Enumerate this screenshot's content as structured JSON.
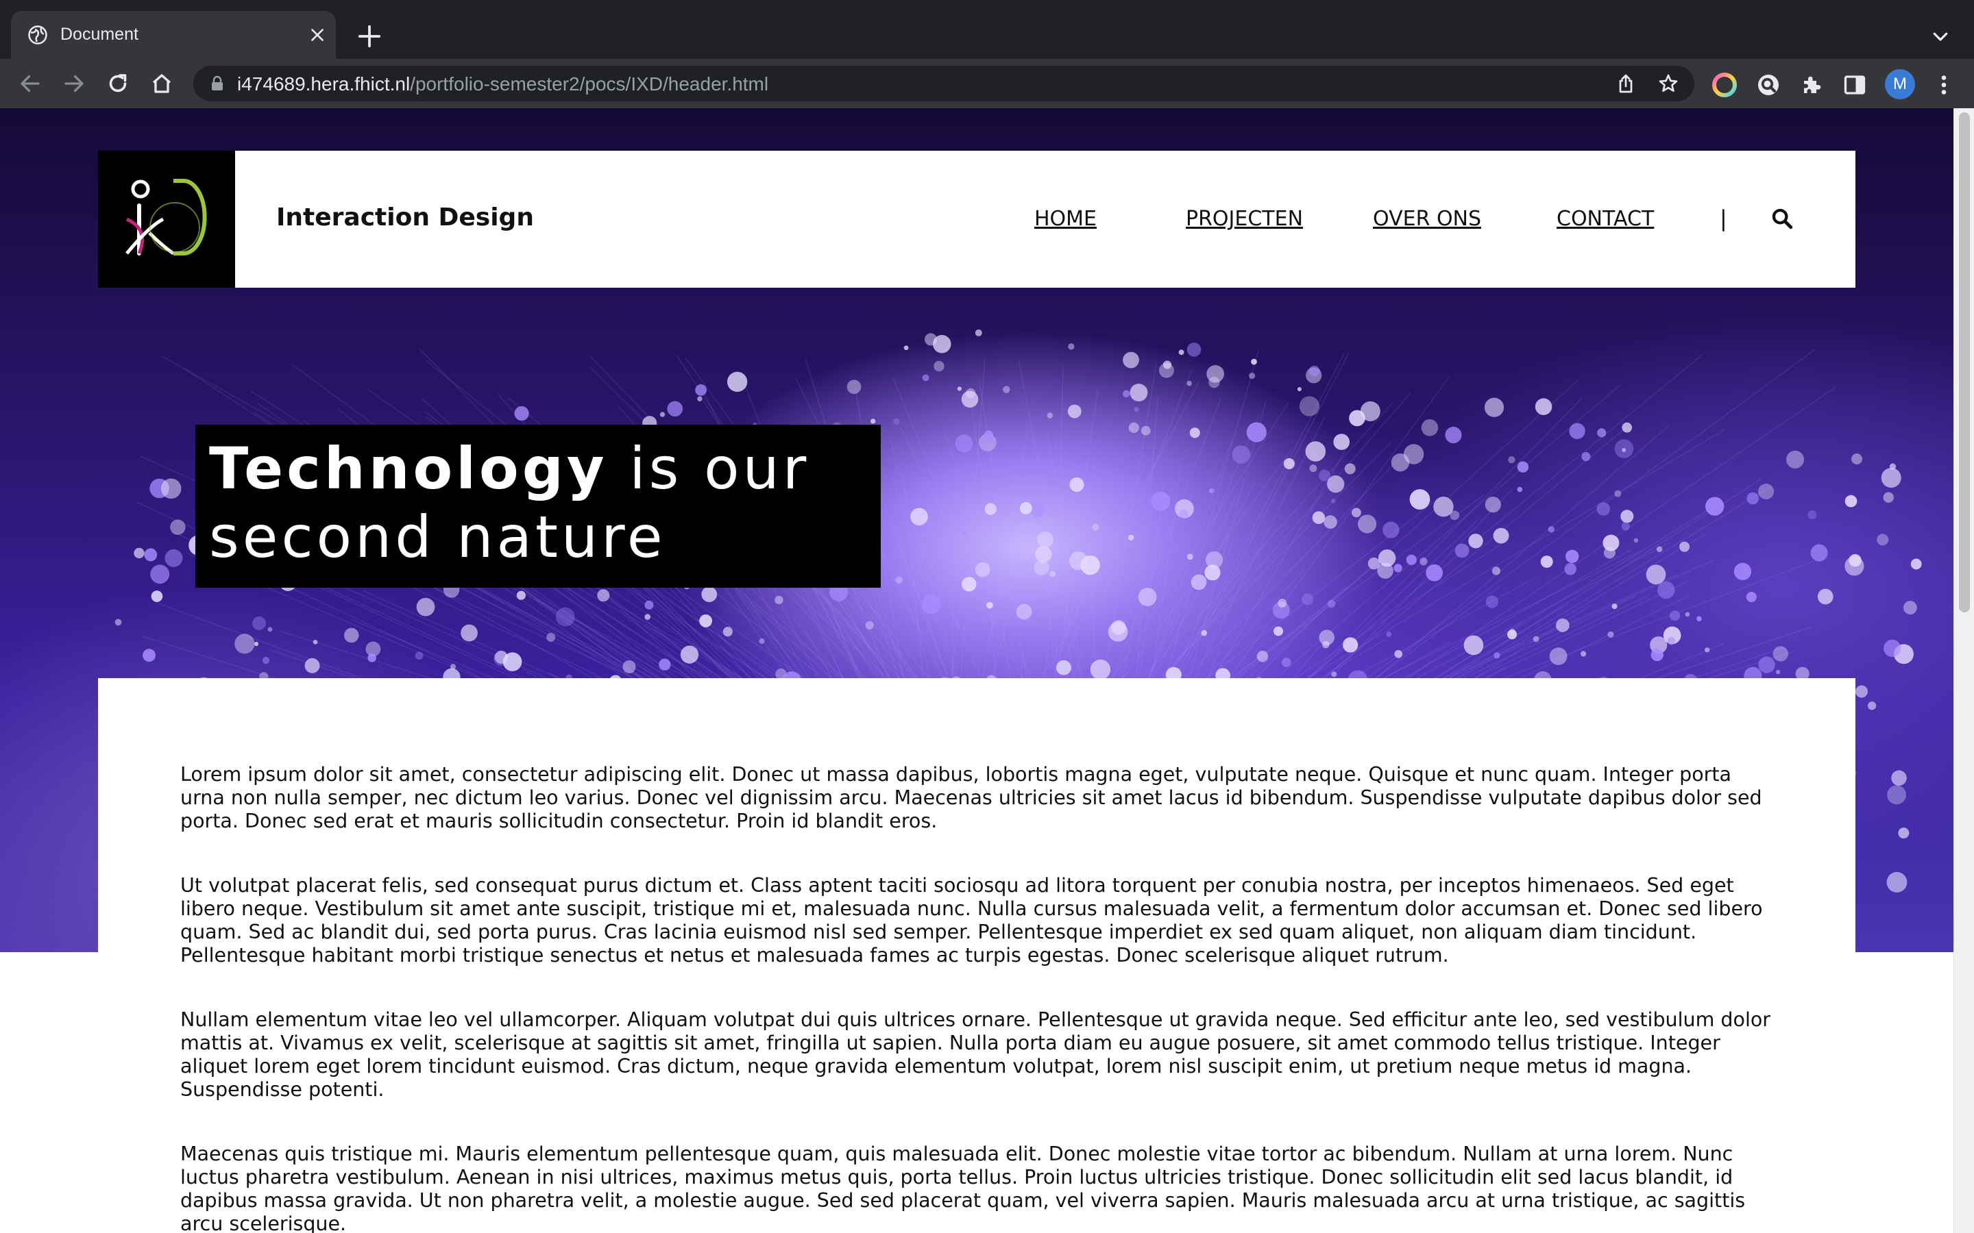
{
  "browser": {
    "tab_title": "Document",
    "url_host": "i474689.hera.fhict.nl",
    "url_path": "/portfolio-semester2/pocs/IXD/header.html",
    "profile_initial": "M"
  },
  "site": {
    "logo_text": "ixd",
    "title": "Interaction Design",
    "nav": [
      {
        "label": "HOME"
      },
      {
        "label": "PROJECTEN"
      },
      {
        "label": "OVER ONS"
      },
      {
        "label": "CONTACT"
      }
    ],
    "nav_separator": "|",
    "tagline_bold": "Technology",
    "tagline_rest_1": " is our",
    "tagline_rest_2": "second nature"
  },
  "content": {
    "paragraphs": [
      "Lorem ipsum dolor sit amet, consectetur adipiscing elit. Donec ut massa dapibus, lobortis magna eget, vulputate neque. Quisque et nunc quam. Integer porta urna non nulla semper, nec dictum leo varius. Donec vel dignissim arcu. Maecenas ultricies sit amet lacus id bibendum. Suspendisse vulputate dapibus dolor sed porta. Donec sed erat et mauris sollicitudin consectetur. Proin id blandit eros.",
      "Ut volutpat placerat felis, sed consequat purus dictum et. Class aptent taciti sociosqu ad litora torquent per conubia nostra, per inceptos himenaeos. Sed eget libero neque. Vestibulum sit amet ante suscipit, tristique mi et, malesuada nunc. Nulla cursus malesuada velit, a fermentum dolor accumsan et. Donec sed libero quam. Sed ac blandit dui, sed porta purus. Cras lacinia euismod nisl sed semper. Pellentesque imperdiet ex sed quam aliquet, non aliquam diam tincidunt. Pellentesque habitant morbi tristique senectus et netus et malesuada fames ac turpis egestas. Donec scelerisque aliquet rutrum.",
      "Nullam elementum vitae leo vel ullamcorper. Aliquam volutpat dui quis ultrices ornare. Pellentesque ut gravida neque. Sed efficitur ante leo, sed vestibulum dolor mattis at. Vivamus ex velit, scelerisque at sagittis sit amet, fringilla ut sapien. Nulla porta diam eu augue posuere, sit amet commodo tellus tristique. Integer aliquet lorem eget lorem tincidunt euismod. Cras dictum, neque gravida elementum volutpat, lorem nisl suscipit enim, ut pretium neque metus id magna. Suspendisse potenti.",
      "Maecenas quis tristique mi. Mauris elementum pellentesque quam, quis malesuada elit. Donec molestie vitae tortor ac bibendum. Nullam at urna lorem. Nunc luctus pharetra vestibulum. Aenean in nisi ultrices, maximus metus quis, porta tellus. Proin luctus ultricies tristique. Donec sollicitudin elit sed lacus blandit, id dapibus massa gravida. Ut non pharetra velit, a molestie augue. Sed sed placerat quam, vel viverra sapien. Mauris malesuada arcu at urna tristique, ac sagittis arcu scelerisque."
    ]
  },
  "colors": {
    "chrome_dark": "#202124",
    "chrome_toolbar": "#35363a",
    "hero_purple": "#6c48d8",
    "logo_green": "#9bc53d",
    "logo_magenta": "#c2257a",
    "header_white": "#ffffff",
    "text_dark": "#111111"
  },
  "icons": [
    "globe-icon",
    "close-icon",
    "plus-icon",
    "chevron-down-icon",
    "back-arrow-icon",
    "forward-arrow-icon",
    "reload-icon",
    "home-icon",
    "lock-icon",
    "share-icon",
    "star-icon",
    "color-extension-icon",
    "search-extension-icon",
    "puzzle-icon",
    "sidepanel-icon",
    "kebab-menu-icon",
    "search-icon"
  ]
}
